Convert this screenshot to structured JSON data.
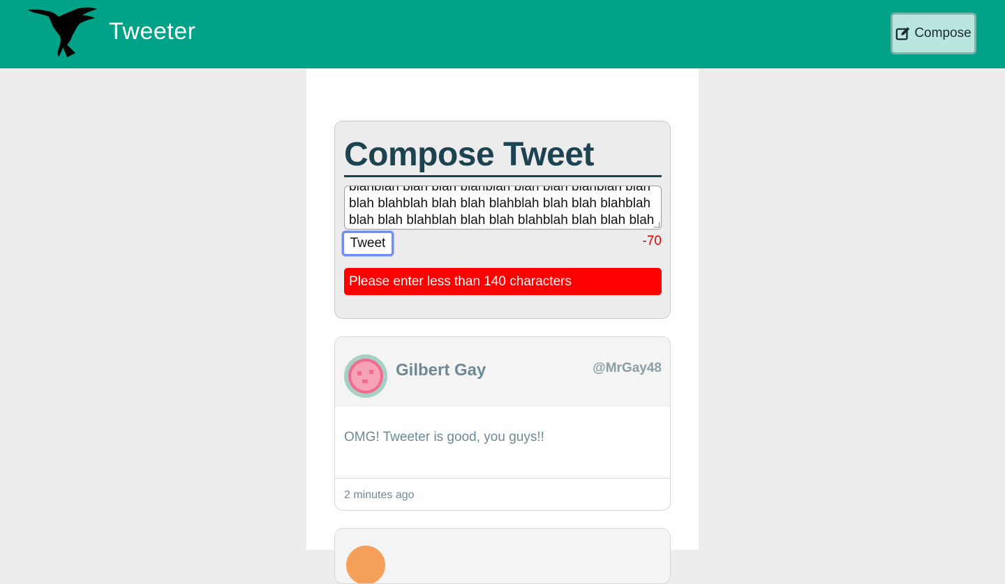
{
  "nav": {
    "brand": "Tweeter",
    "compose_label": "Compose",
    "logo_icon": "hummingbird-logo",
    "compose_icon": "edit-icon"
  },
  "composer": {
    "title": "Compose Tweet",
    "text_lines": [
      "blahblah blah blah blahblah blah blah blahblah blah",
      "blah blahblah blah blah blahblah blah blah blahblah",
      "blah blah blahblah blah blah blahblah blah blah blah"
    ],
    "submit_label": "Tweet",
    "counter": "-70",
    "error": "Please enter less than 140 characters"
  },
  "tweets": [
    {
      "name": "Gilbert Gay",
      "handle": "@MrGay48",
      "content": "OMG! Tweeter is good, you guys!!",
      "time": "2 minutes ago"
    }
  ],
  "colors": {
    "nav_bg": "#00a388",
    "heading": "#1d4350",
    "error_bg": "#ff0000",
    "counter": "#e60000"
  }
}
